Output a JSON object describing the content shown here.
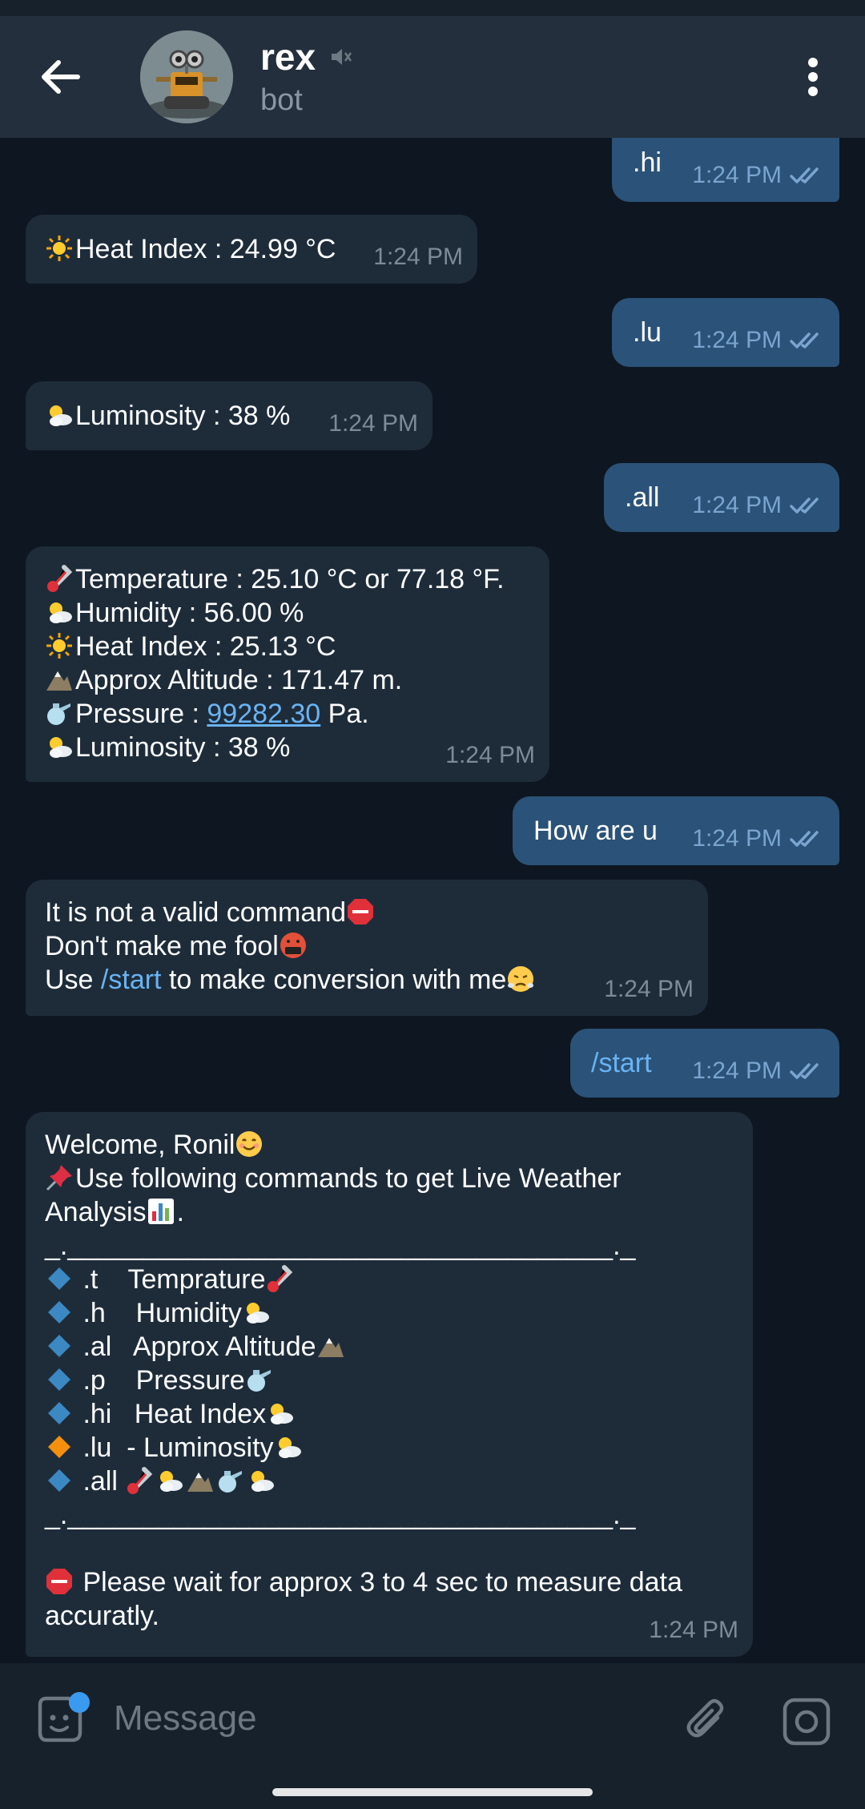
{
  "header": {
    "title": "rex",
    "subtitle": "bot",
    "muted_icon": "muted-speaker-icon"
  },
  "messages": [
    {
      "dir": "out",
      "lines": [
        ".hi"
      ],
      "time": "1:24 PM",
      "status": "read"
    },
    {
      "dir": "in",
      "lines": [
        "Heat Index : 24.99 °C"
      ],
      "time": "1:24 PM"
    },
    {
      "dir": "out",
      "lines": [
        ".lu"
      ],
      "time": "1:24 PM",
      "status": "read"
    },
    {
      "dir": "in",
      "lines": [
        "Luminosity : 38 %"
      ],
      "time": "1:24 PM"
    },
    {
      "dir": "out",
      "lines": [
        ".all"
      ],
      "time": "1:24 PM",
      "status": "read"
    },
    {
      "dir": "in",
      "lines": [
        "Temperature : 25.10 °C or 77.18 °F.",
        "Humidity : 56.00 %",
        "Heat Index : 25.13 °C",
        "Approx Altitude : 171.47 m.",
        "Pressure : ",
        "Luminosity : 38 %"
      ],
      "pressure_value": "99282.30",
      "pressure_unit": " Pa.",
      "time": "1:24 PM"
    },
    {
      "dir": "out",
      "lines": [
        "How are u"
      ],
      "time": "1:24 PM",
      "status": "read"
    },
    {
      "dir": "in",
      "lines": [
        "It is not a valid command",
        "Don't make me fool",
        "Use ",
        " to make conversion with me"
      ],
      "command": "/start",
      "time": "1:24 PM"
    },
    {
      "dir": "out",
      "lines": [
        "/start"
      ],
      "time": "1:24 PM",
      "status": "read"
    },
    {
      "dir": "in",
      "lines": [
        "Welcome, Ronil",
        "Use following commands to get Live Weather",
        "Analysis",
        "_.____________________________________._",
        ".t    Temprature",
        ".h    Humidity",
        ".al   Approx Altitude",
        ".p    Pressure",
        ".hi   Heat Index",
        ".lu  - Luminosity",
        ".all ",
        "_.____________________________________._",
        "",
        " Please wait for approx 3 to 4 sec to measure data",
        "accuratly."
      ],
      "time": "1:24 PM"
    }
  ],
  "input": {
    "placeholder": "Message"
  },
  "colors": {
    "background": "#0e1621",
    "header": "#242f3d",
    "incoming": "#1e2c3a",
    "outgoing": "#2b5278",
    "accent": "#6ab3f3"
  }
}
